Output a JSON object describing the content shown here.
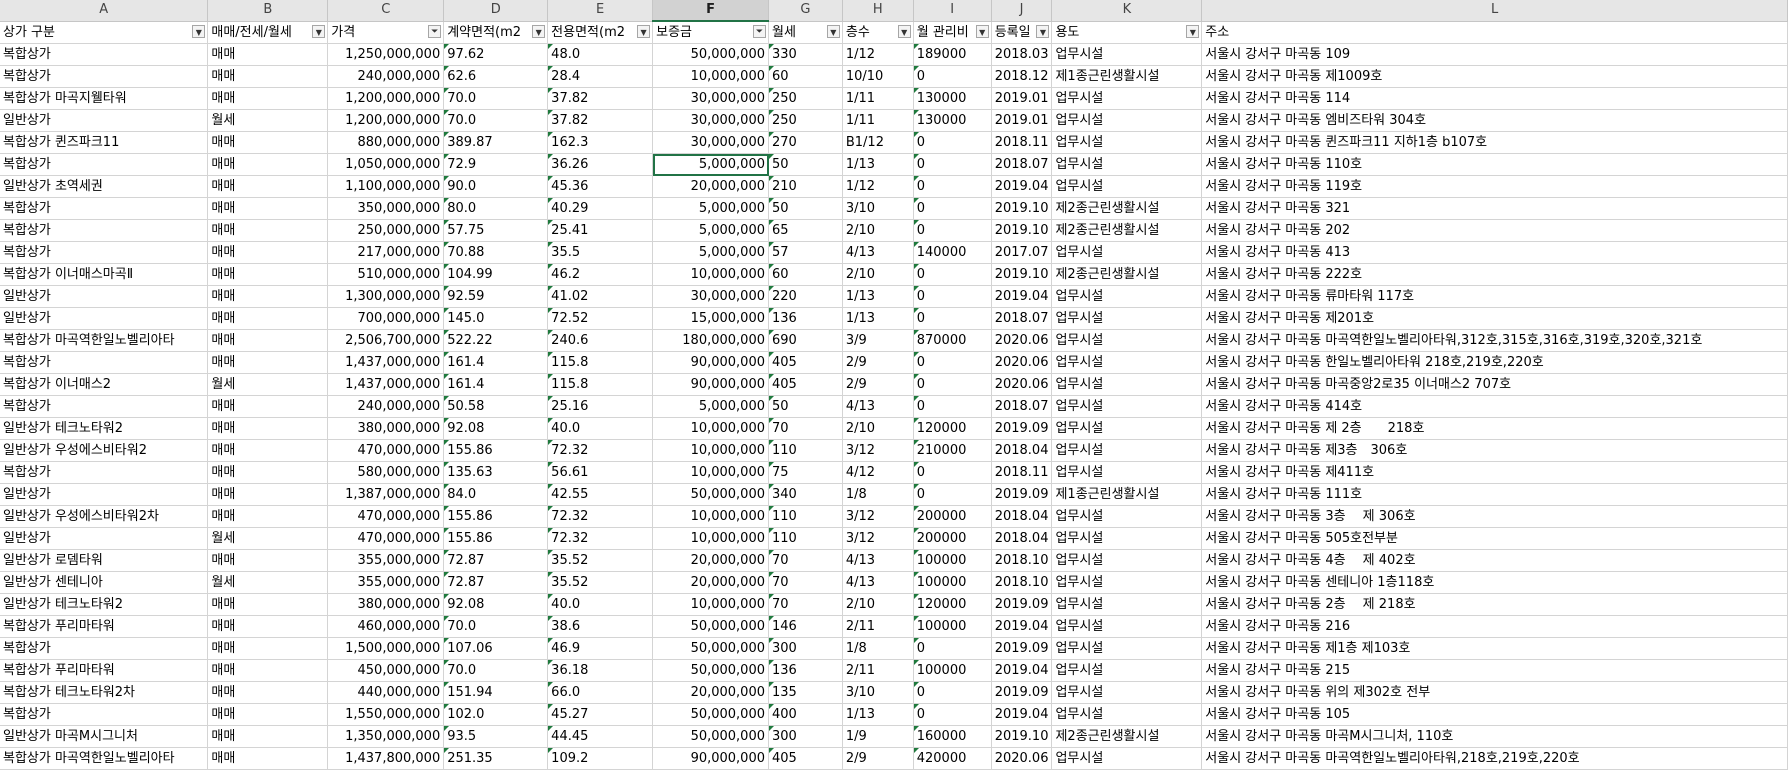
{
  "columns": [
    "A",
    "B",
    "C",
    "D",
    "E",
    "F",
    "G",
    "H",
    "I",
    "J",
    "K",
    "L"
  ],
  "selected_column": "F",
  "headers": [
    {
      "label": "상가 구분",
      "filter": "dropdown"
    },
    {
      "label": "매매/전세/월세",
      "filter": "dropdown"
    },
    {
      "label": "가격",
      "filter": "filtered"
    },
    {
      "label": "계약면적(m2",
      "filter": "dropdown"
    },
    {
      "label": "전용면적(m2",
      "filter": "dropdown"
    },
    {
      "label": "보증금",
      "filter": "filtered"
    },
    {
      "label": "월세",
      "filter": "dropdown"
    },
    {
      "label": "층수",
      "filter": "dropdown"
    },
    {
      "label": "월 관리비",
      "filter": "dropdown"
    },
    {
      "label": "등록일",
      "filter": "dropdown"
    },
    {
      "label": "용도",
      "filter": "dropdown"
    },
    {
      "label": "주소",
      "filter": "none"
    }
  ],
  "active_cell": {
    "row": 5,
    "col": 5
  },
  "rows": [
    [
      "복합상가",
      "매매",
      "1,250,000,000",
      "97.62",
      "48.0",
      "50,000,000",
      "330",
      "1/12",
      "189000",
      "2018.03",
      "업무시설",
      "서울시 강서구 마곡동 109"
    ],
    [
      "복합상가",
      "매매",
      "240,000,000",
      "62.6",
      "28.4",
      "10,000,000",
      "60",
      "10/10",
      "0",
      "2018.12",
      "제1종근린생활시설",
      "서울시 강서구 마곡동 제1009호"
    ],
    [
      "복합상가 마곡지웰타워",
      "매매",
      "1,200,000,000",
      "70.0",
      "37.82",
      "30,000,000",
      "250",
      "1/11",
      "130000",
      "2019.01",
      "업무시설",
      "서울시 강서구 마곡동 114"
    ],
    [
      "일반상가",
      "월세",
      "1,200,000,000",
      "70.0",
      "37.82",
      "30,000,000",
      "250",
      "1/11",
      "130000",
      "2019.01",
      "업무시설",
      "서울시 강서구 마곡동 엠비즈타워 304호"
    ],
    [
      "복합상가 퀸즈파크11",
      "매매",
      "880,000,000",
      "389.87",
      "162.3",
      "30,000,000",
      "270",
      "B1/12",
      "0",
      "2018.11",
      "업무시설",
      "서울시 강서구 마곡동 퀸즈파크11 지하1층 b107호"
    ],
    [
      "복합상가",
      "매매",
      "1,050,000,000",
      "72.9",
      "36.26",
      "5,000,000",
      "50",
      "1/13",
      "0",
      "2018.07",
      "업무시설",
      "서울시 강서구 마곡동 110호"
    ],
    [
      "일반상가 초역세권",
      "매매",
      "1,100,000,000",
      "90.0",
      "45.36",
      "20,000,000",
      "210",
      "1/12",
      "0",
      "2019.04",
      "업무시설",
      "서울시 강서구 마곡동 119호"
    ],
    [
      "복합상가",
      "매매",
      "350,000,000",
      "80.0",
      "40.29",
      "5,000,000",
      "50",
      "3/10",
      "0",
      "2019.10",
      "제2종근린생활시설",
      "서울시 강서구 마곡동 321"
    ],
    [
      "복합상가",
      "매매",
      "250,000,000",
      "57.75",
      "25.41",
      "5,000,000",
      "65",
      "2/10",
      "0",
      "2019.10",
      "제2종근린생활시설",
      "서울시 강서구 마곡동 202"
    ],
    [
      "복합상가",
      "매매",
      "217,000,000",
      "70.88",
      "35.5",
      "5,000,000",
      "57",
      "4/13",
      "140000",
      "2017.07",
      "업무시설",
      "서울시 강서구 마곡동 413"
    ],
    [
      "복합상가 이너매스마곡Ⅱ",
      "매매",
      "510,000,000",
      "104.99",
      "46.2",
      "10,000,000",
      "60",
      "2/10",
      "0",
      "2019.10",
      "제2종근린생활시설",
      "서울시 강서구 마곡동 222호"
    ],
    [
      "일반상가",
      "매매",
      "1,300,000,000",
      "92.59",
      "41.02",
      "30,000,000",
      "220",
      "1/13",
      "0",
      "2019.04",
      "업무시설",
      "서울시 강서구 마곡동 류마타워 117호"
    ],
    [
      "일반상가",
      "매매",
      "700,000,000",
      "145.0",
      "72.52",
      "15,000,000",
      "136",
      "1/13",
      "0",
      "2018.07",
      "업무시설",
      "서울시 강서구 마곡동 제201호"
    ],
    [
      "복합상가 마곡역한일노벨리아타",
      "매매",
      "2,506,700,000",
      "522.22",
      "240.6",
      "180,000,000",
      "690",
      "3/9",
      "870000",
      "2020.06",
      "업무시설",
      "서울시 강서구 마곡동 마곡역한일노벨리아타워,312호,315호,316호,319호,320호,321호"
    ],
    [
      "복합상가",
      "매매",
      "1,437,000,000",
      "161.4",
      "115.8",
      "90,000,000",
      "405",
      "2/9",
      "0",
      "2020.06",
      "업무시설",
      "서울시 강서구 마곡동 한일노벨리아타워 218호,219호,220호"
    ],
    [
      "복합상가 이너매스2",
      "월세",
      "1,437,000,000",
      "161.4",
      "115.8",
      "90,000,000",
      "405",
      "2/9",
      "0",
      "2020.06",
      "업무시설",
      "서울시 강서구 마곡동 마곡중앙2로35 이너매스2 707호"
    ],
    [
      "복합상가",
      "매매",
      "240,000,000",
      "50.58",
      "25.16",
      "5,000,000",
      "50",
      "4/13",
      "0",
      "2018.07",
      "업무시설",
      "서울시 강서구 마곡동 414호"
    ],
    [
      "일반상가 테크노타워2",
      "매매",
      "380,000,000",
      "92.08",
      "40.0",
      "10,000,000",
      "70",
      "2/10",
      "120000",
      "2019.09",
      "업무시설",
      "서울시 강서구 마곡동 제 2층　　218호"
    ],
    [
      "일반상가 우성에스비타워2",
      "매매",
      "470,000,000",
      "155.86",
      "72.32",
      "10,000,000",
      "110",
      "3/12",
      "210000",
      "2018.04",
      "업무시설",
      "서울시 강서구 마곡동 제3층　306호"
    ],
    [
      "복합상가",
      "매매",
      "580,000,000",
      "135.63",
      "56.61",
      "10,000,000",
      "75",
      "4/12",
      "0",
      "2018.11",
      "업무시설",
      "서울시 강서구 마곡동 제411호"
    ],
    [
      "일반상가",
      "매매",
      "1,387,000,000",
      "84.0",
      "42.55",
      "50,000,000",
      "340",
      "1/8",
      "0",
      "2019.09",
      "제1종근린생활시설",
      "서울시 강서구 마곡동 111호"
    ],
    [
      "일반상가 우성에스비타워2차",
      "매매",
      "470,000,000",
      "155.86",
      "72.32",
      "10,000,000",
      "110",
      "3/12",
      "200000",
      "2018.04",
      "업무시설",
      "서울시 강서구 마곡동 3층　 제 306호"
    ],
    [
      "일반상가",
      "월세",
      "470,000,000",
      "155.86",
      "72.32",
      "10,000,000",
      "110",
      "3/12",
      "200000",
      "2018.04",
      "업무시설",
      "서울시 강서구 마곡동 505호전부분"
    ],
    [
      "일반상가 로뎀타워",
      "매매",
      "355,000,000",
      "72.87",
      "35.52",
      "20,000,000",
      "70",
      "4/13",
      "100000",
      "2018.10",
      "업무시설",
      "서울시 강서구 마곡동 4층　 제 402호"
    ],
    [
      "일반상가 센테니아",
      "월세",
      "355,000,000",
      "72.87",
      "35.52",
      "20,000,000",
      "70",
      "4/13",
      "100000",
      "2018.10",
      "업무시설",
      "서울시 강서구 마곡동 센테니아 1층118호"
    ],
    [
      "일반상가 테크노타워2",
      "매매",
      "380,000,000",
      "92.08",
      "40.0",
      "10,000,000",
      "70",
      "2/10",
      "120000",
      "2019.09",
      "업무시설",
      "서울시 강서구 마곡동 2층　 제 218호"
    ],
    [
      "복합상가 푸리마타워",
      "매매",
      "460,000,000",
      "70.0",
      "38.6",
      "50,000,000",
      "146",
      "2/11",
      "100000",
      "2019.04",
      "업무시설",
      "서울시 강서구 마곡동 216"
    ],
    [
      "복합상가",
      "매매",
      "1,500,000,000",
      "107.06",
      "46.9",
      "50,000,000",
      "300",
      "1/8",
      "0",
      "2019.09",
      "업무시설",
      "서울시 강서구 마곡동 제1층 제103호"
    ],
    [
      "복합상가 푸리마타워",
      "매매",
      "450,000,000",
      "70.0",
      "36.18",
      "50,000,000",
      "136",
      "2/11",
      "100000",
      "2019.04",
      "업무시설",
      "서울시 강서구 마곡동 215"
    ],
    [
      "복합상가 테크노타워2차",
      "매매",
      "440,000,000",
      "151.94",
      "66.0",
      "20,000,000",
      "135",
      "3/10",
      "0",
      "2019.09",
      "업무시설",
      "서울시 강서구 마곡동 위의 제302호 전부"
    ],
    [
      "복합상가",
      "매매",
      "1,550,000,000",
      "102.0",
      "45.27",
      "50,000,000",
      "400",
      "1/13",
      "0",
      "2019.04",
      "업무시설",
      "서울시 강서구 마곡동 105"
    ],
    [
      "일반상가 마곡M시그니처",
      "매매",
      "1,350,000,000",
      "93.5",
      "44.45",
      "50,000,000",
      "300",
      "1/9",
      "160000",
      "2019.10",
      "제2종근린생활시설",
      "서울시 강서구 마곡동 마곡M시그니처, 110호"
    ],
    [
      "복합상가 마곡역한일노벨리아타",
      "매매",
      "1,437,800,000",
      "251.35",
      "109.2",
      "90,000,000",
      "405",
      "2/9",
      "420000",
      "2020.06",
      "업무시설",
      "서울시 강서구 마곡동 마곡역한일노벨리아타워,218호,219호,220호"
    ]
  ]
}
